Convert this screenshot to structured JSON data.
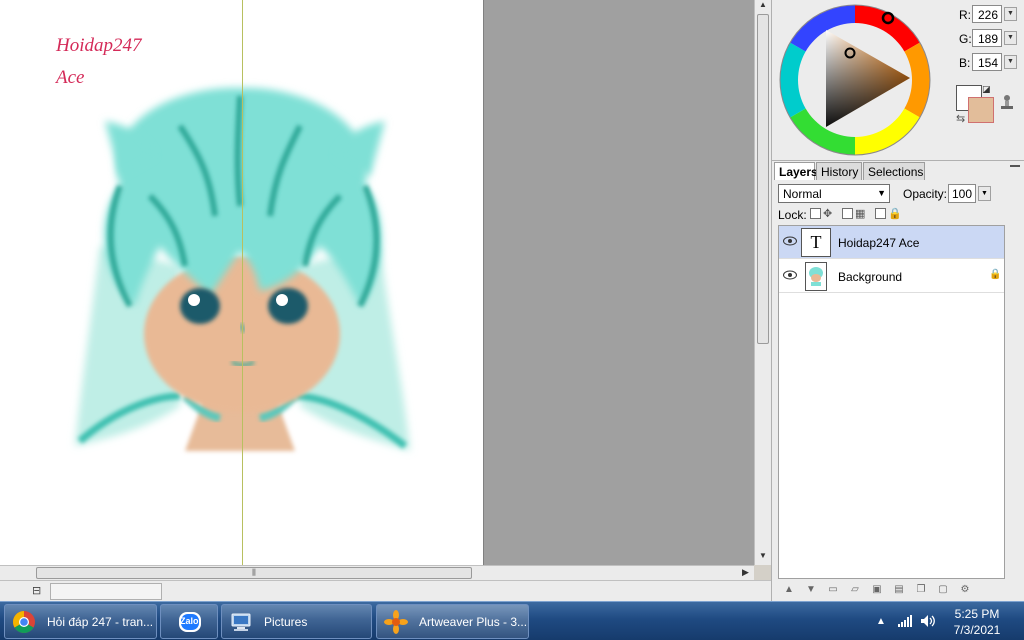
{
  "canvas": {
    "text_line1": "Hoidap247",
    "text_line2": "Ace"
  },
  "color_picker": {
    "r_label": "R:",
    "g_label": "G:",
    "b_label": "B:",
    "r_value": "226",
    "g_value": "189",
    "b_value": "154",
    "foreground_color": "#e2bd9a",
    "background_color": "#ffffff"
  },
  "panel": {
    "tabs": [
      {
        "label": "Layers"
      },
      {
        "label": "History"
      },
      {
        "label": "Selections"
      }
    ],
    "blend_mode": "Normal",
    "opacity_label": "Opacity:",
    "opacity_value": "100",
    "lock_label": "Lock:",
    "layers": [
      {
        "name": "Hoidap247 Ace",
        "thumb": "T"
      },
      {
        "name": "Background"
      }
    ]
  },
  "taskbar": {
    "items": [
      {
        "label": "Hỏi đáp 247 - tran..."
      },
      {
        "label": "Zalo"
      },
      {
        "label": "Pictures"
      },
      {
        "label": "Artweaver Plus - 3..."
      }
    ],
    "clock_time": "5:25 PM",
    "clock_date": "7/3/2021"
  }
}
